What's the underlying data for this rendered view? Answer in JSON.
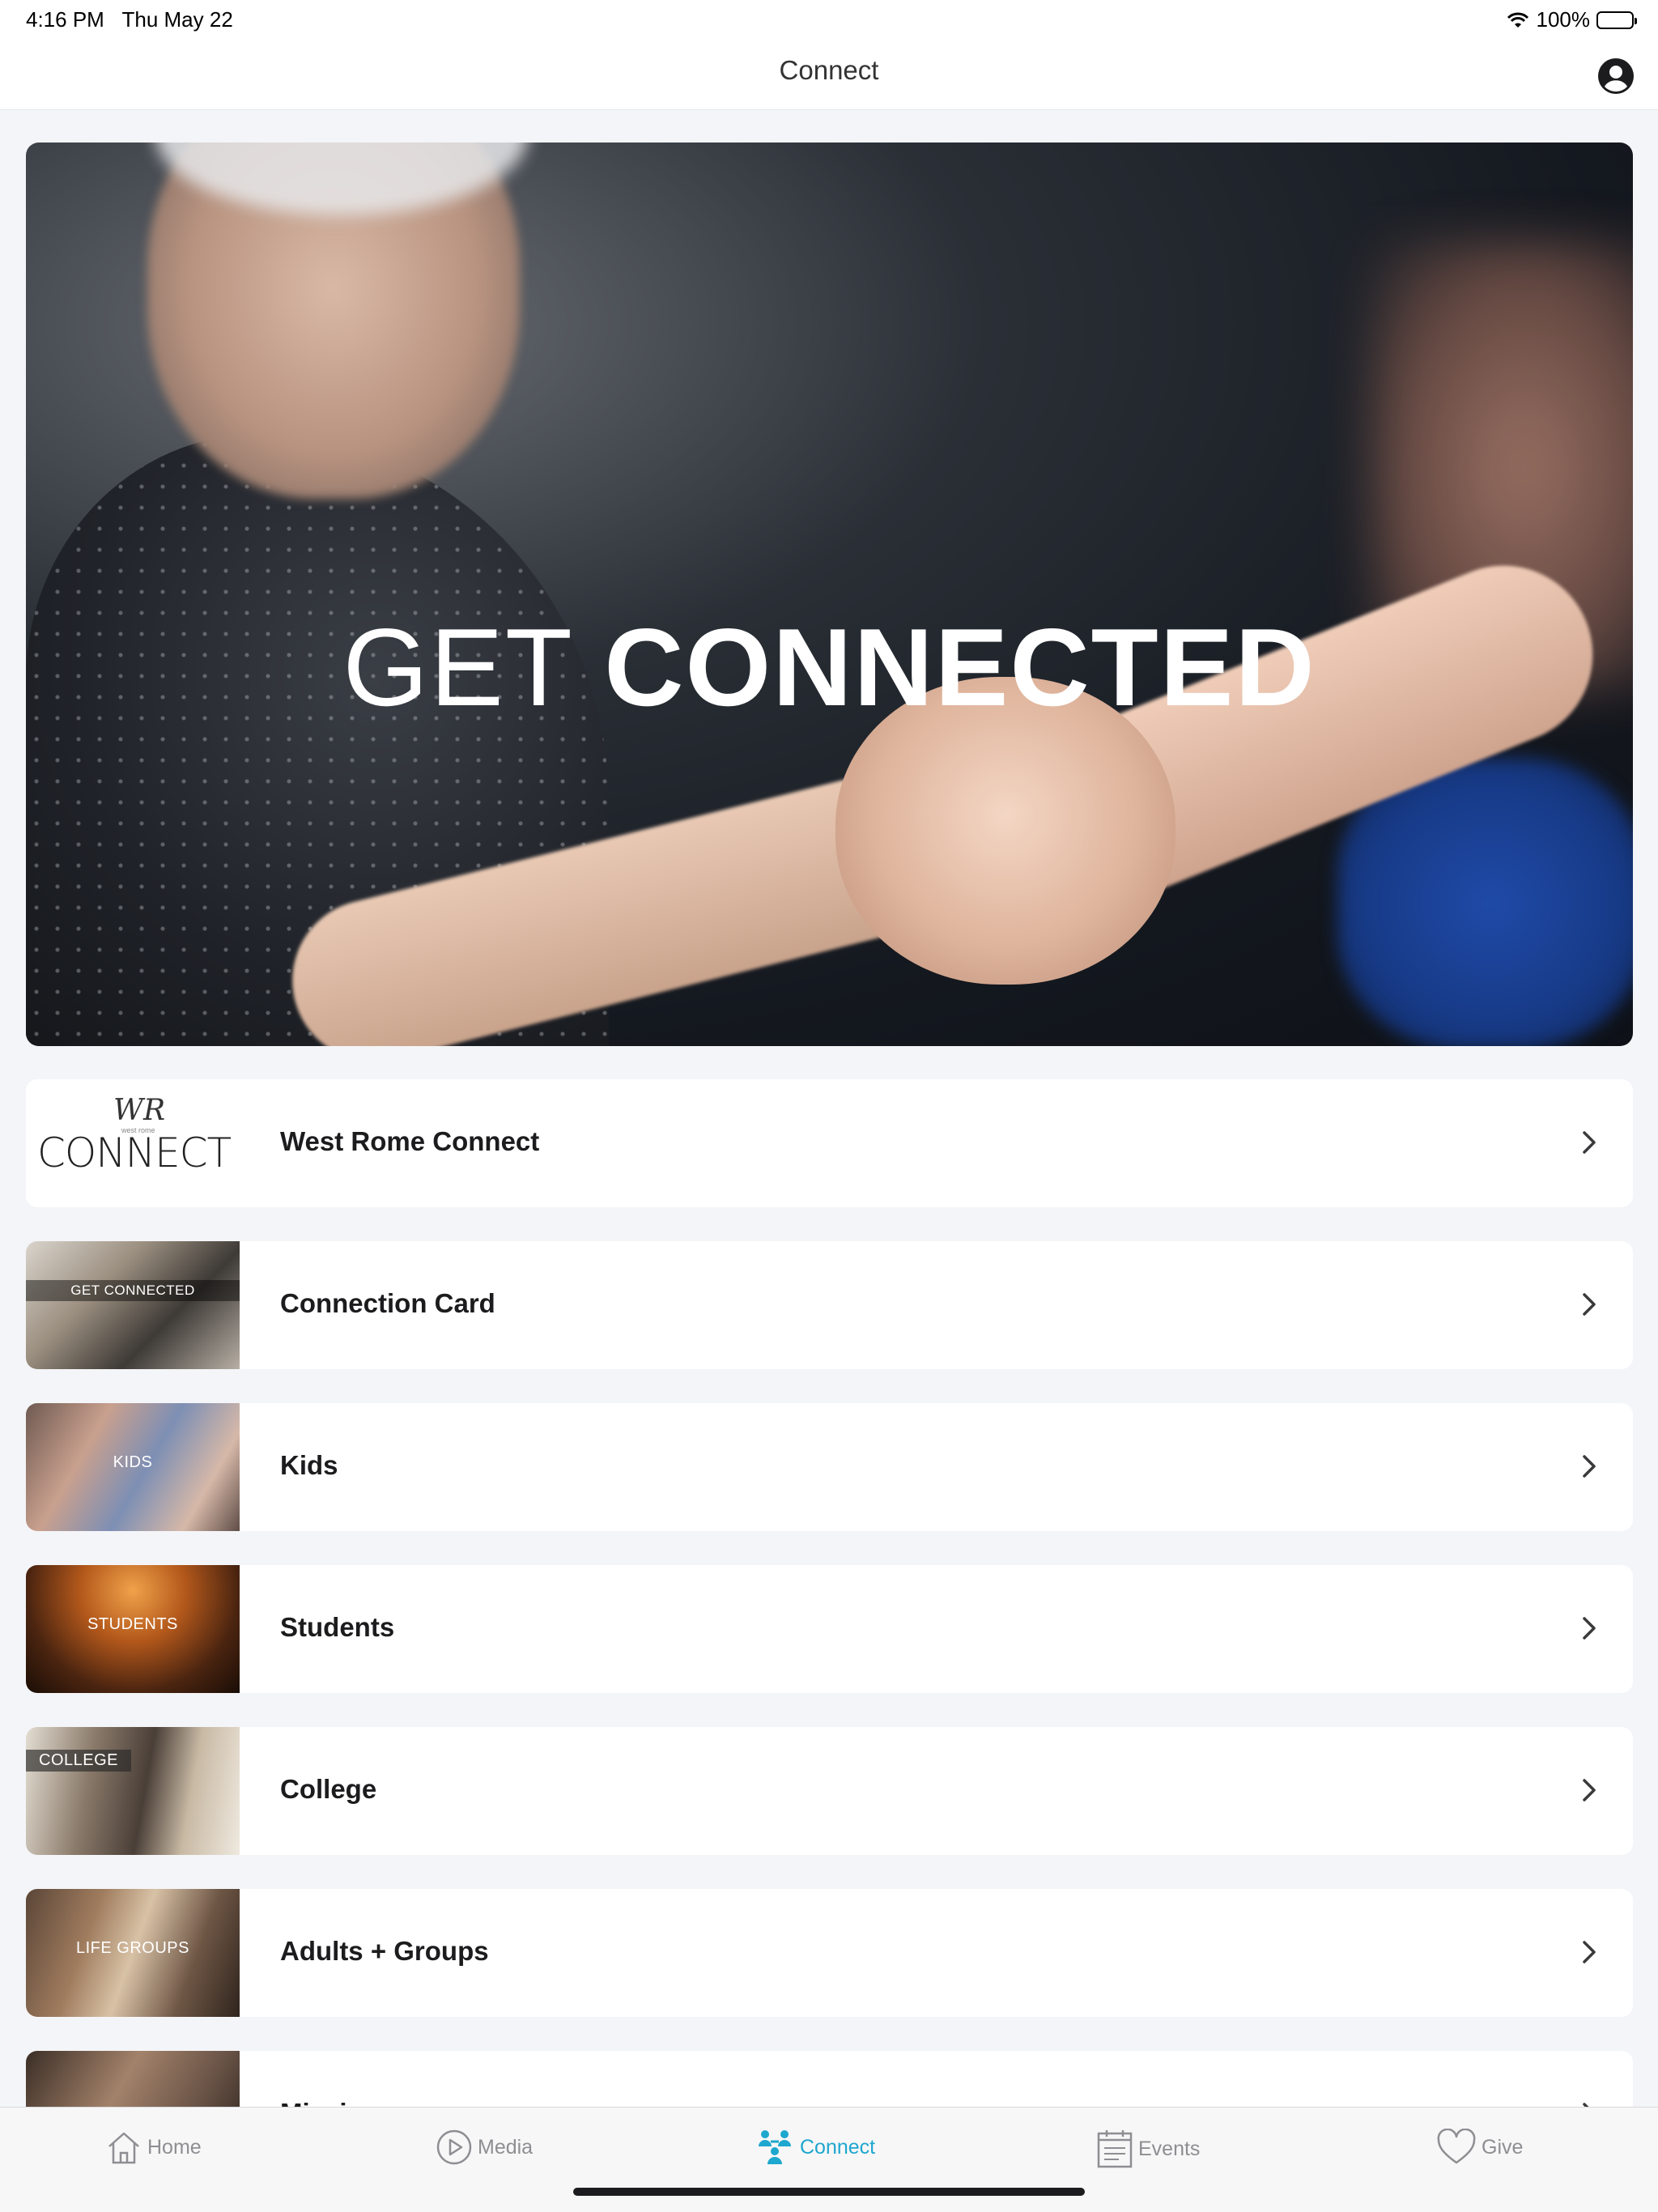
{
  "status_bar": {
    "time": "4:16 PM",
    "date": "Thu May 22",
    "battery": "100%",
    "battery_level": 1.0
  },
  "nav": {
    "title": "Connect",
    "profile_icon": "person-circle-icon"
  },
  "hero": {
    "title_light": "GET",
    "title_bold": "CONNECTED"
  },
  "list": {
    "items": [
      {
        "title": "West Rome Connect",
        "thumb_text": "CONNECT",
        "thumb_script": "WR",
        "thumb_small": "west rome"
      },
      {
        "title": "Connection Card",
        "thumb_text": "GET CONNECTED"
      },
      {
        "title": "Kids",
        "thumb_text": "KIDS"
      },
      {
        "title": "Students",
        "thumb_text": "STUDENTS"
      },
      {
        "title": "College",
        "thumb_text": "COLLEGE"
      },
      {
        "title": "Adults + Groups",
        "thumb_text": "LIFE GROUPS"
      },
      {
        "title": "Missions",
        "thumb_text": ""
      }
    ]
  },
  "tabs": [
    {
      "label": "Home",
      "icon": "home-icon"
    },
    {
      "label": "Media",
      "icon": "play-circle-icon"
    },
    {
      "label": "Connect",
      "icon": "people-icon",
      "active": true
    },
    {
      "label": "Events",
      "icon": "calendar-icon"
    },
    {
      "label": "Give",
      "icon": "heart-icon"
    }
  ],
  "colors": {
    "accent": "#1ea7cf",
    "background": "#f4f5f8",
    "card": "#ffffff"
  }
}
